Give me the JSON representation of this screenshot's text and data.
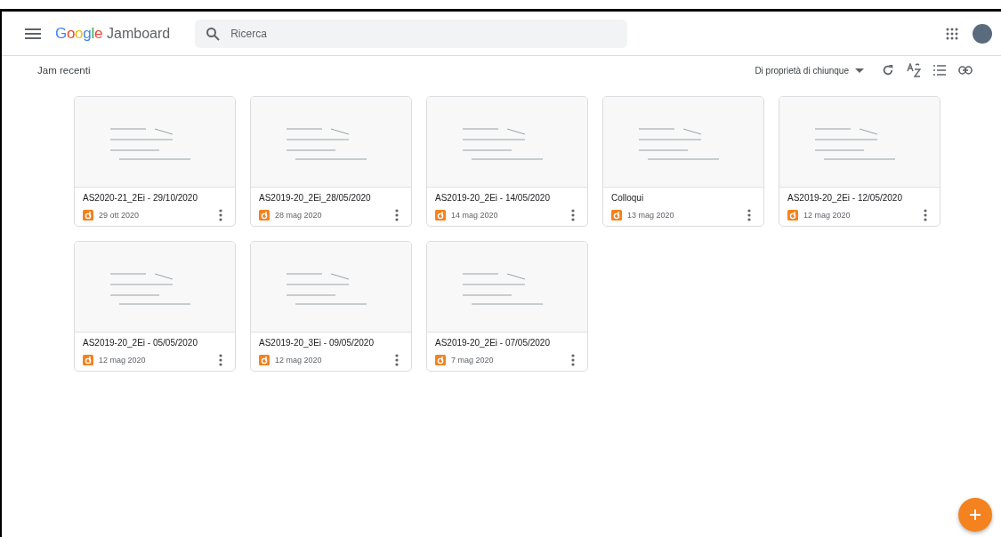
{
  "header": {
    "product": "Jamboard",
    "logo_letters": [
      "G",
      "o",
      "o",
      "g",
      "l",
      "e"
    ],
    "search": {
      "placeholder": "Ricerca"
    }
  },
  "toolbar": {
    "title": "Jam recenti",
    "owner_filter": "Di proprietà di chiunque"
  },
  "jams": [
    {
      "title": "AS2020-21_2Ei - 29/10/2020",
      "date": "29 ott 2020"
    },
    {
      "title": "AS2019-20_2Ei_28/05/2020",
      "date": "28 mag 2020"
    },
    {
      "title": "AS2019-20_2Ei - 14/05/2020",
      "date": "14 mag 2020"
    },
    {
      "title": "Colloqui",
      "date": "13 mag 2020"
    },
    {
      "title": "AS2019-20_2Ei - 12/05/2020",
      "date": "12 mag 2020"
    },
    {
      "title": "AS2019-20_2Ei - 05/05/2020",
      "date": "12 mag 2020"
    },
    {
      "title": "AS2019-20_3Ei - 09/05/2020",
      "date": "12 mag 2020"
    },
    {
      "title": "AS2019-20_2Ei - 07/05/2020",
      "date": "7 mag 2020"
    }
  ]
}
